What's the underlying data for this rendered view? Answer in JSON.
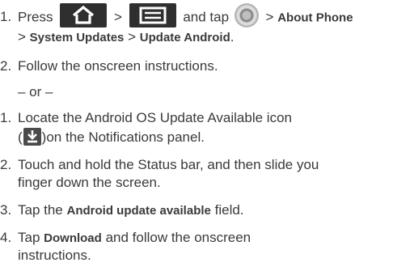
{
  "steps_a": [
    {
      "num": "1.",
      "press": "Press",
      "gt": ">",
      "and_tap": "and tap",
      "about_phone": "About Phone",
      "system_updates": "System Updates",
      "update_android": "Update Android",
      "icons": [
        "home-icon",
        "menu-icon",
        "settings-icon"
      ]
    },
    {
      "num": "2.",
      "text": "Follow the onscreen instructions."
    }
  ],
  "or_text": "– or –",
  "steps_b": [
    {
      "num": "1.",
      "line1": "Locate the Android OS Update Available icon",
      "open": "(",
      "line2_rest": ")on the Notifications panel.",
      "icon": "update-available-icon"
    },
    {
      "num": "2.",
      "line1": "Touch and hold the Status bar, and then slide you",
      "line2": "finger down the screen."
    },
    {
      "num": "3.",
      "tap": "Tap the",
      "bold": "Android update available",
      "rest": "field."
    },
    {
      "num": "4.",
      "tap": "Tap",
      "bold": "Download",
      "rest": "and follow the onscreen",
      "line2": "instructions."
    }
  ],
  "colors": {
    "text": "#3a3a3a",
    "icon_bg": "#2f2f2f",
    "icon_fg": "#ffffff"
  }
}
